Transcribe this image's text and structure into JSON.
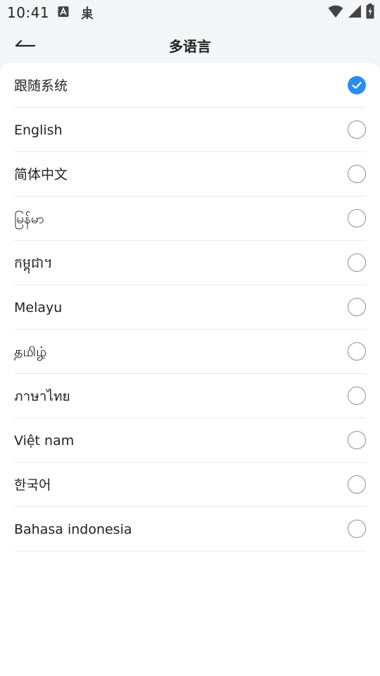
{
  "status_bar": {
    "time": "10:41",
    "left_icons": [
      "font-a-icon",
      "bug-icon"
    ],
    "right_icons": [
      "wifi-icon",
      "cell-signal-icon",
      "battery-charging-icon"
    ]
  },
  "header": {
    "back_icon": "arrow-left-icon",
    "title": "多语言"
  },
  "languages": [
    {
      "label": "跟随系统",
      "selected": true
    },
    {
      "label": "English",
      "selected": false
    },
    {
      "label": "简体中文",
      "selected": false
    },
    {
      "label": "မြန်မာ",
      "selected": false
    },
    {
      "label": "កម្ពុជា។",
      "selected": false
    },
    {
      "label": "Melayu",
      "selected": false
    },
    {
      "label": "தமிழ்",
      "selected": false
    },
    {
      "label": "ภาษาไทย",
      "selected": false
    },
    {
      "label": "Việt nam",
      "selected": false
    },
    {
      "label": "한국어",
      "selected": false
    },
    {
      "label": "Bahasa indonesia",
      "selected": false
    }
  ],
  "colors": {
    "accent": "#2b8cf0",
    "background": "#f4f5f7",
    "card": "#ffffff",
    "divider": "#e9e9e9"
  }
}
